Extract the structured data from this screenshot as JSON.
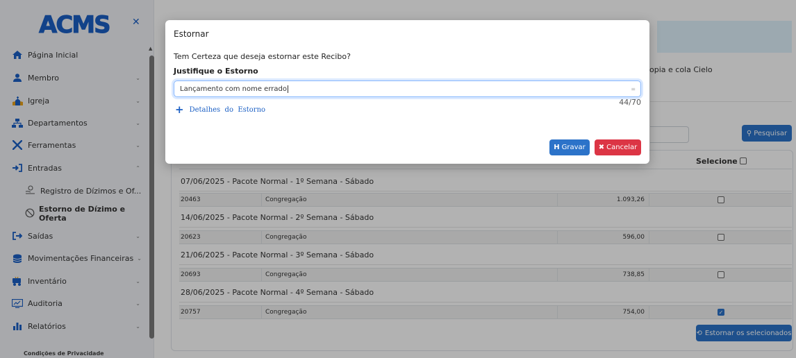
{
  "app": {
    "logo": "ACMS"
  },
  "sidebar": {
    "items": [
      {
        "label": "Página Inicial",
        "icon": "home-icon"
      },
      {
        "label": "Membro",
        "icon": "user-icon"
      },
      {
        "label": "Igreja",
        "icon": "church-icon"
      },
      {
        "label": "Departamentos",
        "icon": "sitemap-icon"
      },
      {
        "label": "Ferramentas",
        "icon": "tools-icon"
      },
      {
        "label": "Entradas",
        "icon": "sign-in-icon"
      },
      {
        "label": "Saídas",
        "icon": "sign-out-icon"
      },
      {
        "label": "Movimentações Financeiras",
        "icon": "coins-icon"
      },
      {
        "label": "Inventário",
        "icon": "dolly-icon"
      },
      {
        "label": "Auditoria",
        "icon": "audit-icon"
      },
      {
        "label": "Relatórios",
        "icon": "chart-icon"
      }
    ],
    "subitems": [
      {
        "label": "Registro de Dízimos e Of...",
        "icon": "hand-coins-icon"
      },
      {
        "label": "Estorno de Dízimo e Oferta",
        "icon": "ban-icon"
      }
    ],
    "footer": "Condições de Privacidade"
  },
  "page": {
    "right_title": "opia e cola Cielo",
    "search_button": "Pesquisar",
    "table_headers": {
      "selecione": "Selecione"
    },
    "groups": [
      {
        "title": "07/06/2025 - Pacote Normal - 1º Semana - Sábado",
        "row": {
          "id": "20463",
          "name": "Congregação",
          "value": "1.093,26",
          "checked": false
        }
      },
      {
        "title": "14/06/2025 - Pacote Normal - 2º Semana - Sábado",
        "row": {
          "id": "20623",
          "name": "Congregação",
          "value": "596,00",
          "checked": false
        }
      },
      {
        "title": "21/06/2025 - Pacote Normal - 3º Semana - Sábado",
        "row": {
          "id": "20693",
          "name": "Congregação",
          "value": "738,85",
          "checked": false
        }
      },
      {
        "title": "28/06/2025 - Pacote Normal - 4º Semana - Sábado",
        "row": {
          "id": "20757",
          "name": "Congregação",
          "value": "754,00",
          "checked": true
        }
      }
    ],
    "estornar_button": "Estornar os selecionados"
  },
  "modal": {
    "title": "Estornar",
    "question": "Tem Certeza que deseja estornar este Recibo?",
    "label": "Justifique o Estorno",
    "input_value": "Lançamento com nome errado",
    "counter": "44/70",
    "details_link": "Detalhes  do  Estorno",
    "gravar": "Gravar",
    "cancelar": "Cancelar"
  },
  "colors": {
    "primary": "#2c73c9",
    "danger": "#dc3545",
    "logo": "#1a5fc4",
    "info_box": "#e0f2fd"
  }
}
